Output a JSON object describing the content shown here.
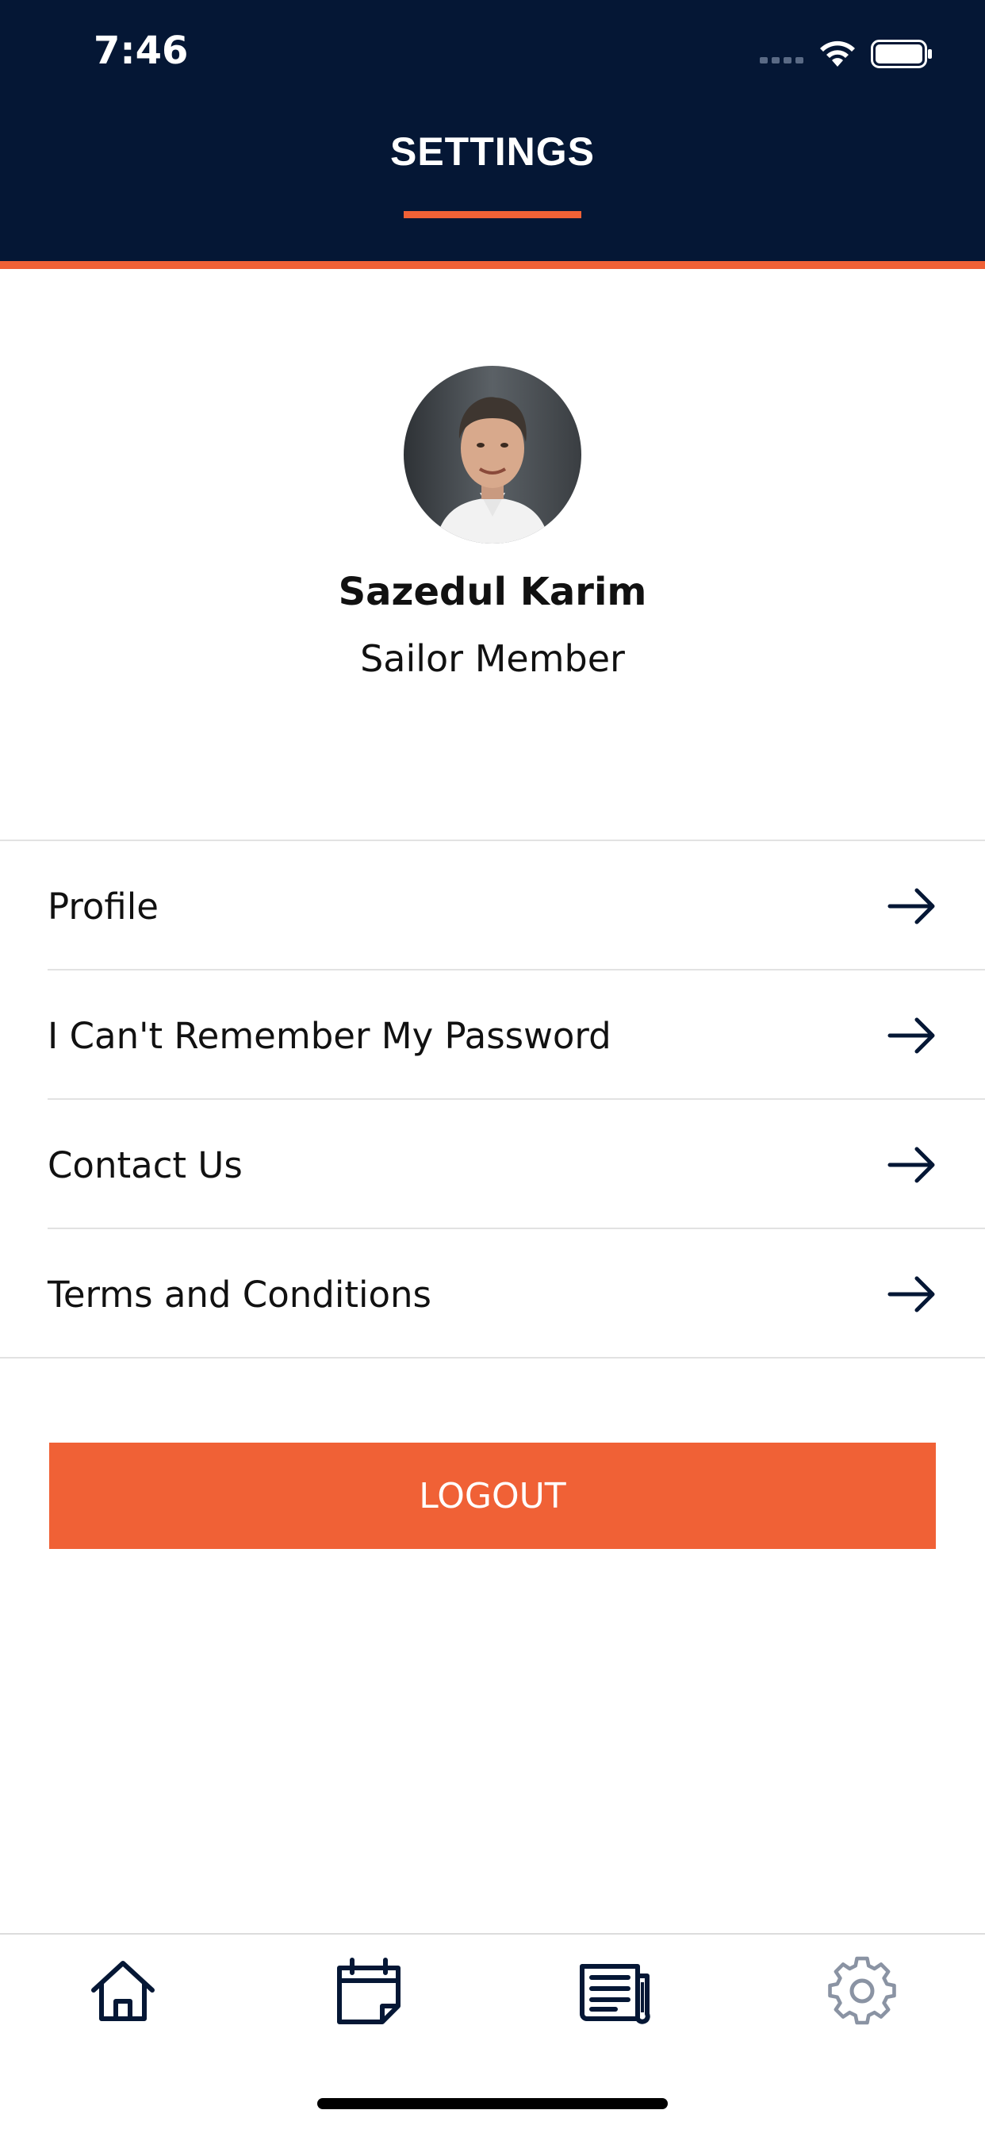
{
  "status_bar": {
    "time": "7:46"
  },
  "header": {
    "title": "SETTINGS"
  },
  "profile": {
    "name": "Sazedul Karim",
    "role": "Sailor Member"
  },
  "menu": {
    "items": [
      {
        "label": "Profile",
        "icon": "arrow-right-icon"
      },
      {
        "label": "I Can't Remember My Password",
        "icon": "arrow-right-icon"
      },
      {
        "label": "Contact Us",
        "icon": "arrow-right-icon"
      },
      {
        "label": "Terms and Conditions",
        "icon": "arrow-right-icon"
      }
    ]
  },
  "logout": {
    "label": "LOGOUT"
  },
  "tabbar": {
    "items": [
      {
        "icon": "home-icon",
        "active": true
      },
      {
        "icon": "calendar-icon",
        "active": true
      },
      {
        "icon": "news-icon",
        "active": true
      },
      {
        "icon": "gear-icon",
        "active": false
      }
    ]
  },
  "colors": {
    "navy": "#051735",
    "accent": "#f06136",
    "inactive_icon": "#8a93a3"
  }
}
